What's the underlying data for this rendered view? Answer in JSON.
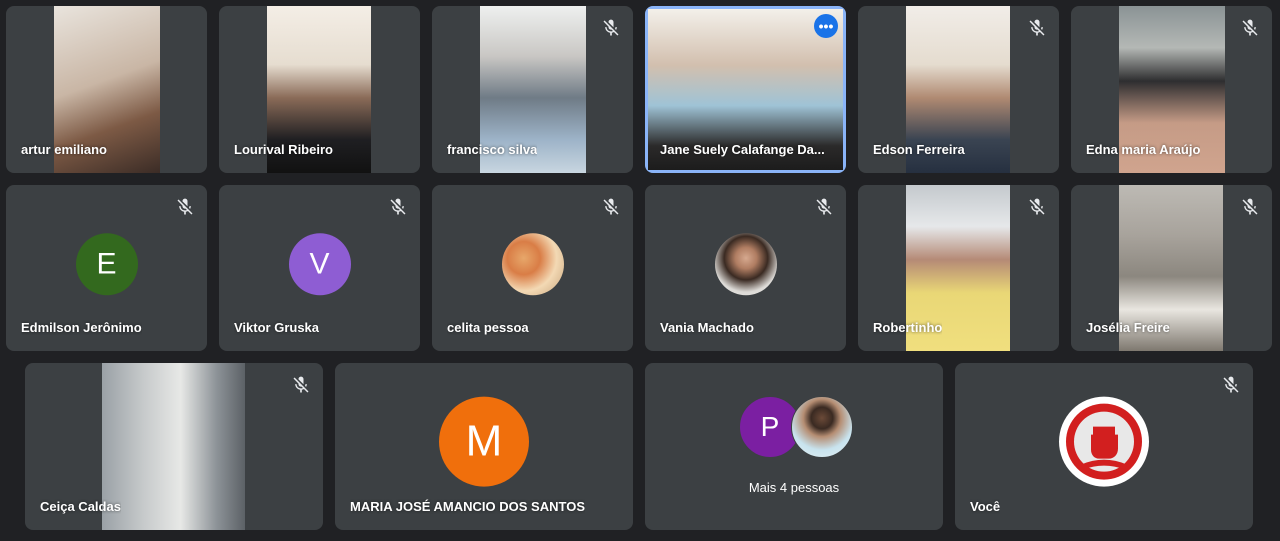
{
  "participants": [
    {
      "name": "artur emiliano"
    },
    {
      "name": "Lourival Ribeiro"
    },
    {
      "name": "francisco silva"
    },
    {
      "name": "Jane Suely Calafange Da..."
    },
    {
      "name": "Edson Ferreira"
    },
    {
      "name": "Edna maria Araújo"
    },
    {
      "name": "Edmilson Jerônimo",
      "initial": "E",
      "color": "#33691e"
    },
    {
      "name": "Viktor Gruska",
      "initial": "V",
      "color": "#8e5dd3"
    },
    {
      "name": "celita pessoa"
    },
    {
      "name": "Vania Machado"
    },
    {
      "name": "Robertinho"
    },
    {
      "name": "Josélia Freire"
    },
    {
      "name": "Ceiça Caldas"
    },
    {
      "name": "MARIA JOSÉ AMANCIO DOS SANTOS",
      "initial": "M",
      "color": "#f06f0c"
    },
    {
      "name": "Mais 4 pessoas",
      "initial": "P",
      "color": "#7b1fa2"
    },
    {
      "name": "Você"
    }
  ],
  "icons": {
    "muted": "mic-off-icon",
    "options": "more-options-icon"
  },
  "colors": {
    "background": "#202124",
    "tile": "#3c4043",
    "active_border": "#8ab4f8"
  }
}
